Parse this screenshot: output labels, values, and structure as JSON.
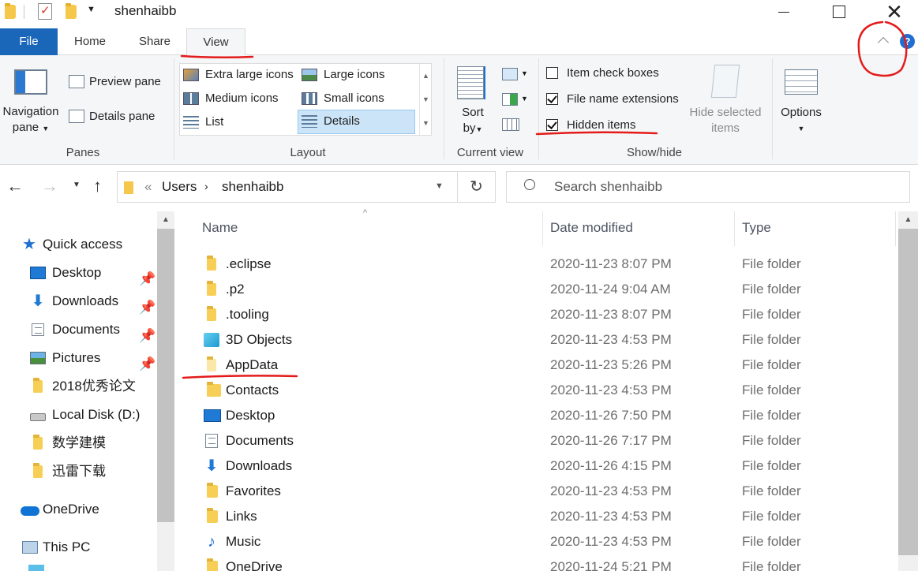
{
  "window": {
    "title": "shenhaibb"
  },
  "ribbon_tabs": [
    "File",
    "Home",
    "Share",
    "View"
  ],
  "ribbon": {
    "panes": {
      "navigation_pane_line1": "Navigation",
      "navigation_pane_line2": "pane",
      "preview_pane": "Preview pane",
      "details_pane": "Details pane",
      "group_label": "Panes"
    },
    "layout": {
      "items": [
        "Extra large icons",
        "Large icons",
        "Medium icons",
        "Small icons",
        "List",
        "Details"
      ],
      "selected": "Details",
      "group_label": "Layout"
    },
    "current_view": {
      "sort_by_line1": "Sort",
      "sort_by_line2": "by",
      "group_label": "Current view"
    },
    "show_hide": {
      "item_check_boxes": "Item check boxes",
      "file_name_extensions": "File name extensions",
      "hidden_items": "Hidden items",
      "item_check_boxes_checked": false,
      "file_name_extensions_checked": true,
      "hidden_items_checked": true,
      "hide_selected_line1": "Hide selected",
      "hide_selected_line2": "items",
      "group_label": "Show/hide"
    },
    "options": {
      "label": "Options"
    }
  },
  "address": {
    "breadcrumb": [
      "Users",
      "shenhaibb"
    ],
    "overflow": "«",
    "search_placeholder": "Search shenhaibb"
  },
  "nav_pane": {
    "quick_access": "Quick access",
    "items": [
      {
        "label": "Desktop",
        "icon": "desktop-icon",
        "pinned": true
      },
      {
        "label": "Downloads",
        "icon": "download-icon",
        "pinned": true
      },
      {
        "label": "Documents",
        "icon": "document-icon",
        "pinned": true
      },
      {
        "label": "Pictures",
        "icon": "picture-icon",
        "pinned": true
      },
      {
        "label": "2018优秀论文",
        "icon": "folder-icon",
        "pinned": false
      },
      {
        "label": "Local Disk (D:)",
        "icon": "drive-icon",
        "pinned": false
      },
      {
        "label": "数学建模",
        "icon": "folder-icon",
        "pinned": false
      },
      {
        "label": "迅雷下载",
        "icon": "folder-icon",
        "pinned": false
      }
    ],
    "onedrive": "OneDrive",
    "this_pc": "This PC"
  },
  "file_list": {
    "columns": [
      "Name",
      "Date modified",
      "Type"
    ],
    "rows": [
      {
        "name": ".eclipse",
        "date": "2020-11-23 8:07 PM",
        "type": "File folder",
        "icon": "folder-icon"
      },
      {
        "name": ".p2",
        "date": "2020-11-24 9:04 AM",
        "type": "File folder",
        "icon": "folder-icon"
      },
      {
        "name": ".tooling",
        "date": "2020-11-23 8:07 PM",
        "type": "File folder",
        "icon": "folder-icon"
      },
      {
        "name": "3D Objects",
        "date": "2020-11-23 4:53 PM",
        "type": "File folder",
        "icon": "3d-objects-icon"
      },
      {
        "name": "AppData",
        "date": "2020-11-23 5:26 PM",
        "type": "File folder",
        "icon": "hidden-folder-icon"
      },
      {
        "name": "Contacts",
        "date": "2020-11-23 4:53 PM",
        "type": "File folder",
        "icon": "contacts-icon"
      },
      {
        "name": "Desktop",
        "date": "2020-11-26 7:50 PM",
        "type": "File folder",
        "icon": "desktop-icon"
      },
      {
        "name": "Documents",
        "date": "2020-11-26 7:17 PM",
        "type": "File folder",
        "icon": "document-icon"
      },
      {
        "name": "Downloads",
        "date": "2020-11-26 4:15 PM",
        "type": "File folder",
        "icon": "download-icon"
      },
      {
        "name": "Favorites",
        "date": "2020-11-23 4:53 PM",
        "type": "File folder",
        "icon": "favorites-icon"
      },
      {
        "name": "Links",
        "date": "2020-11-23 4:53 PM",
        "type": "File folder",
        "icon": "links-icon"
      },
      {
        "name": "Music",
        "date": "2020-11-23 4:53 PM",
        "type": "File folder",
        "icon": "music-icon"
      },
      {
        "name": "OneDrive",
        "date": "2020-11-24 5:21 PM",
        "type": "File folder",
        "icon": "onedrive-icon"
      }
    ]
  },
  "colors": {
    "file_tab": "#1a66b9",
    "annotation": "#e31b1b",
    "selection": "#cce4f7"
  }
}
